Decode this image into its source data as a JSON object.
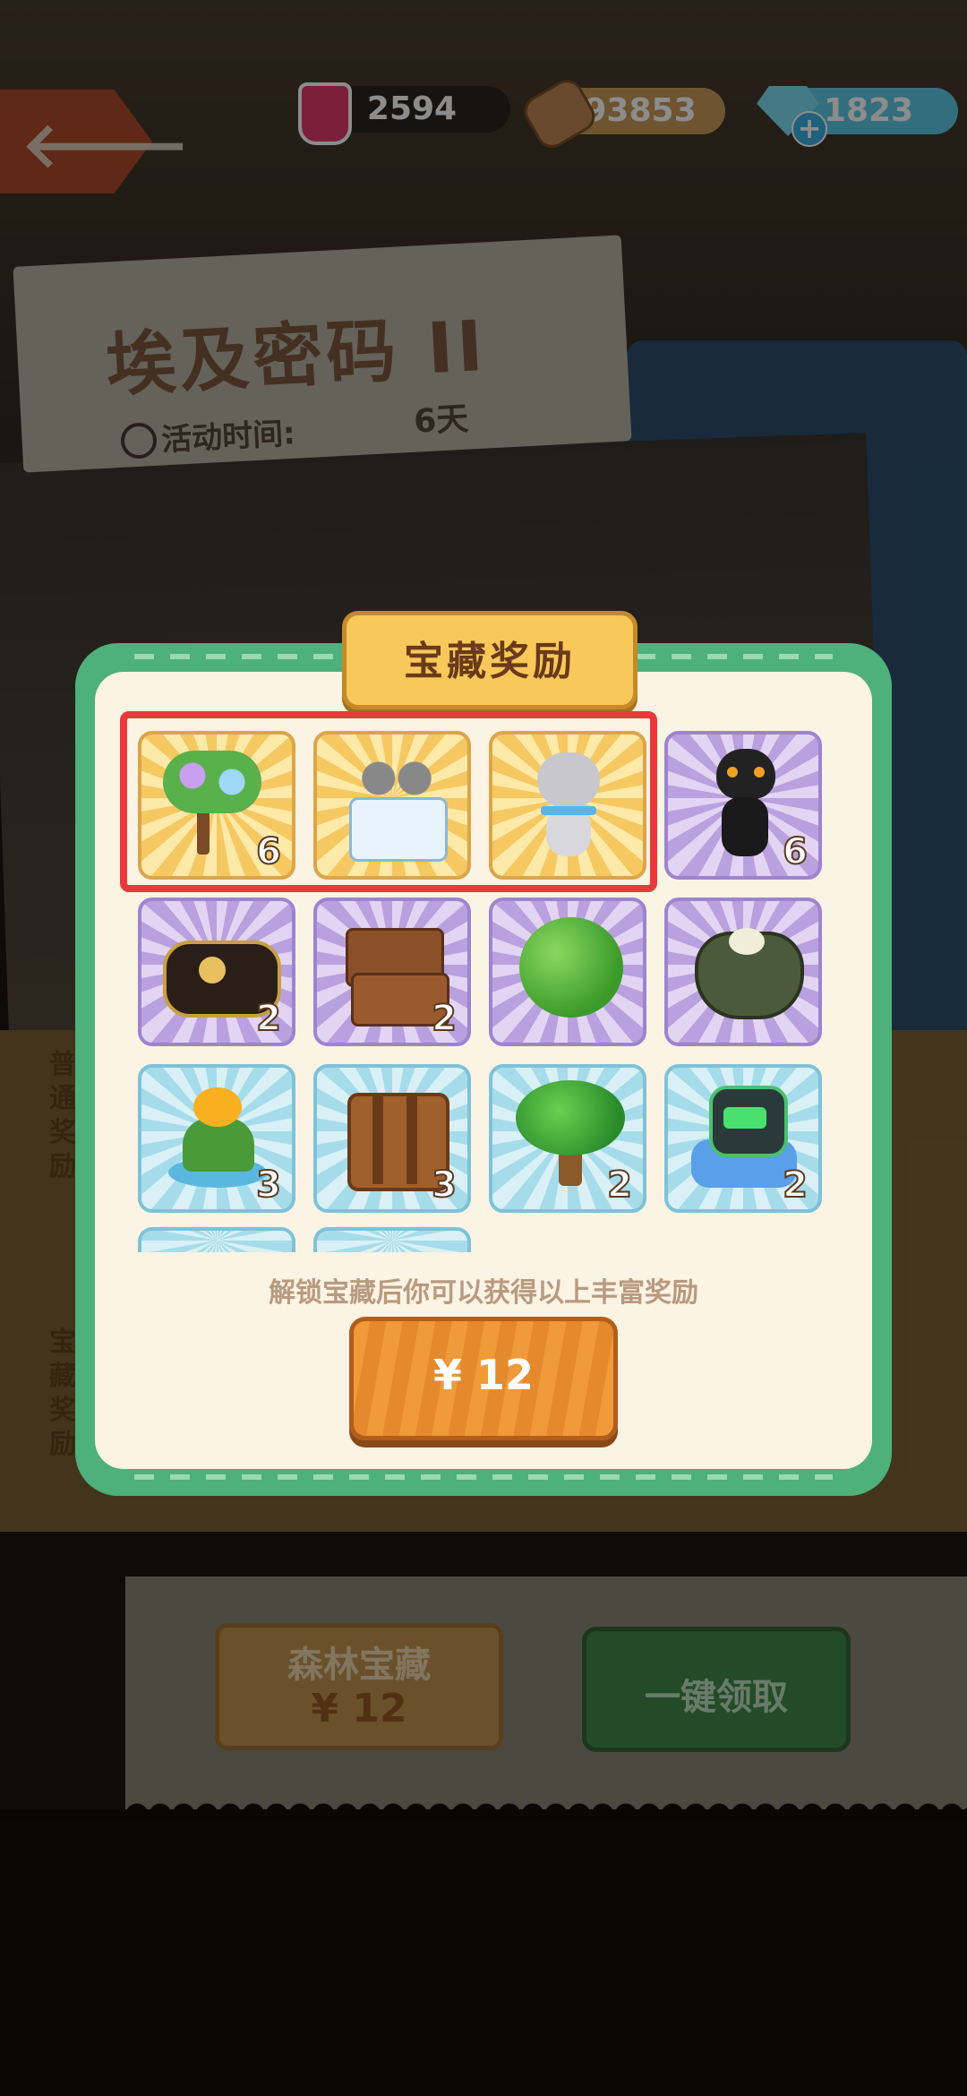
{
  "resources": {
    "potion": "2594",
    "wood": "93853",
    "gems": "1823"
  },
  "event": {
    "title": "埃及密码 II",
    "time_label": "活动时间:",
    "time_value": "6天"
  },
  "side_labels": {
    "normal": "普\n通\n奖\n励",
    "treasure": "宝\n藏\n奖\n励"
  },
  "modal": {
    "title": "宝藏奖励",
    "description": "解锁宝藏后你可以获得以上丰富奖励",
    "price": "¥ 12",
    "rewards": [
      {
        "name": "wisteria-tree",
        "count": "6",
        "bg": "gold"
      },
      {
        "name": "kitten-cake",
        "count": "",
        "bg": "gold"
      },
      {
        "name": "grey-kitten",
        "count": "",
        "bg": "gold"
      },
      {
        "name": "black-cat",
        "count": "6",
        "bg": "purple"
      },
      {
        "name": "clover-bag",
        "count": "2",
        "bg": "purple"
      },
      {
        "name": "treasure-chests",
        "count": "2",
        "bg": "purple"
      },
      {
        "name": "green-bush",
        "count": "",
        "bg": "purple"
      },
      {
        "name": "coin-purse",
        "count": "",
        "bg": "purple"
      },
      {
        "name": "lily-flower",
        "count": "3",
        "bg": "blue"
      },
      {
        "name": "wooden-crate",
        "count": "3",
        "bg": "blue"
      },
      {
        "name": "oak-tree",
        "count": "2",
        "bg": "blue"
      },
      {
        "name": "robot-cat-bed",
        "count": "2",
        "bg": "blue"
      }
    ]
  },
  "bottom": {
    "forest_title": "森林宝藏",
    "forest_price": "¥ 12",
    "claim_all": "一键领取"
  },
  "colors": {
    "modal_frame": "#4eb07a",
    "highlight": "#e83a3a",
    "price_button": "#f09a3a"
  }
}
